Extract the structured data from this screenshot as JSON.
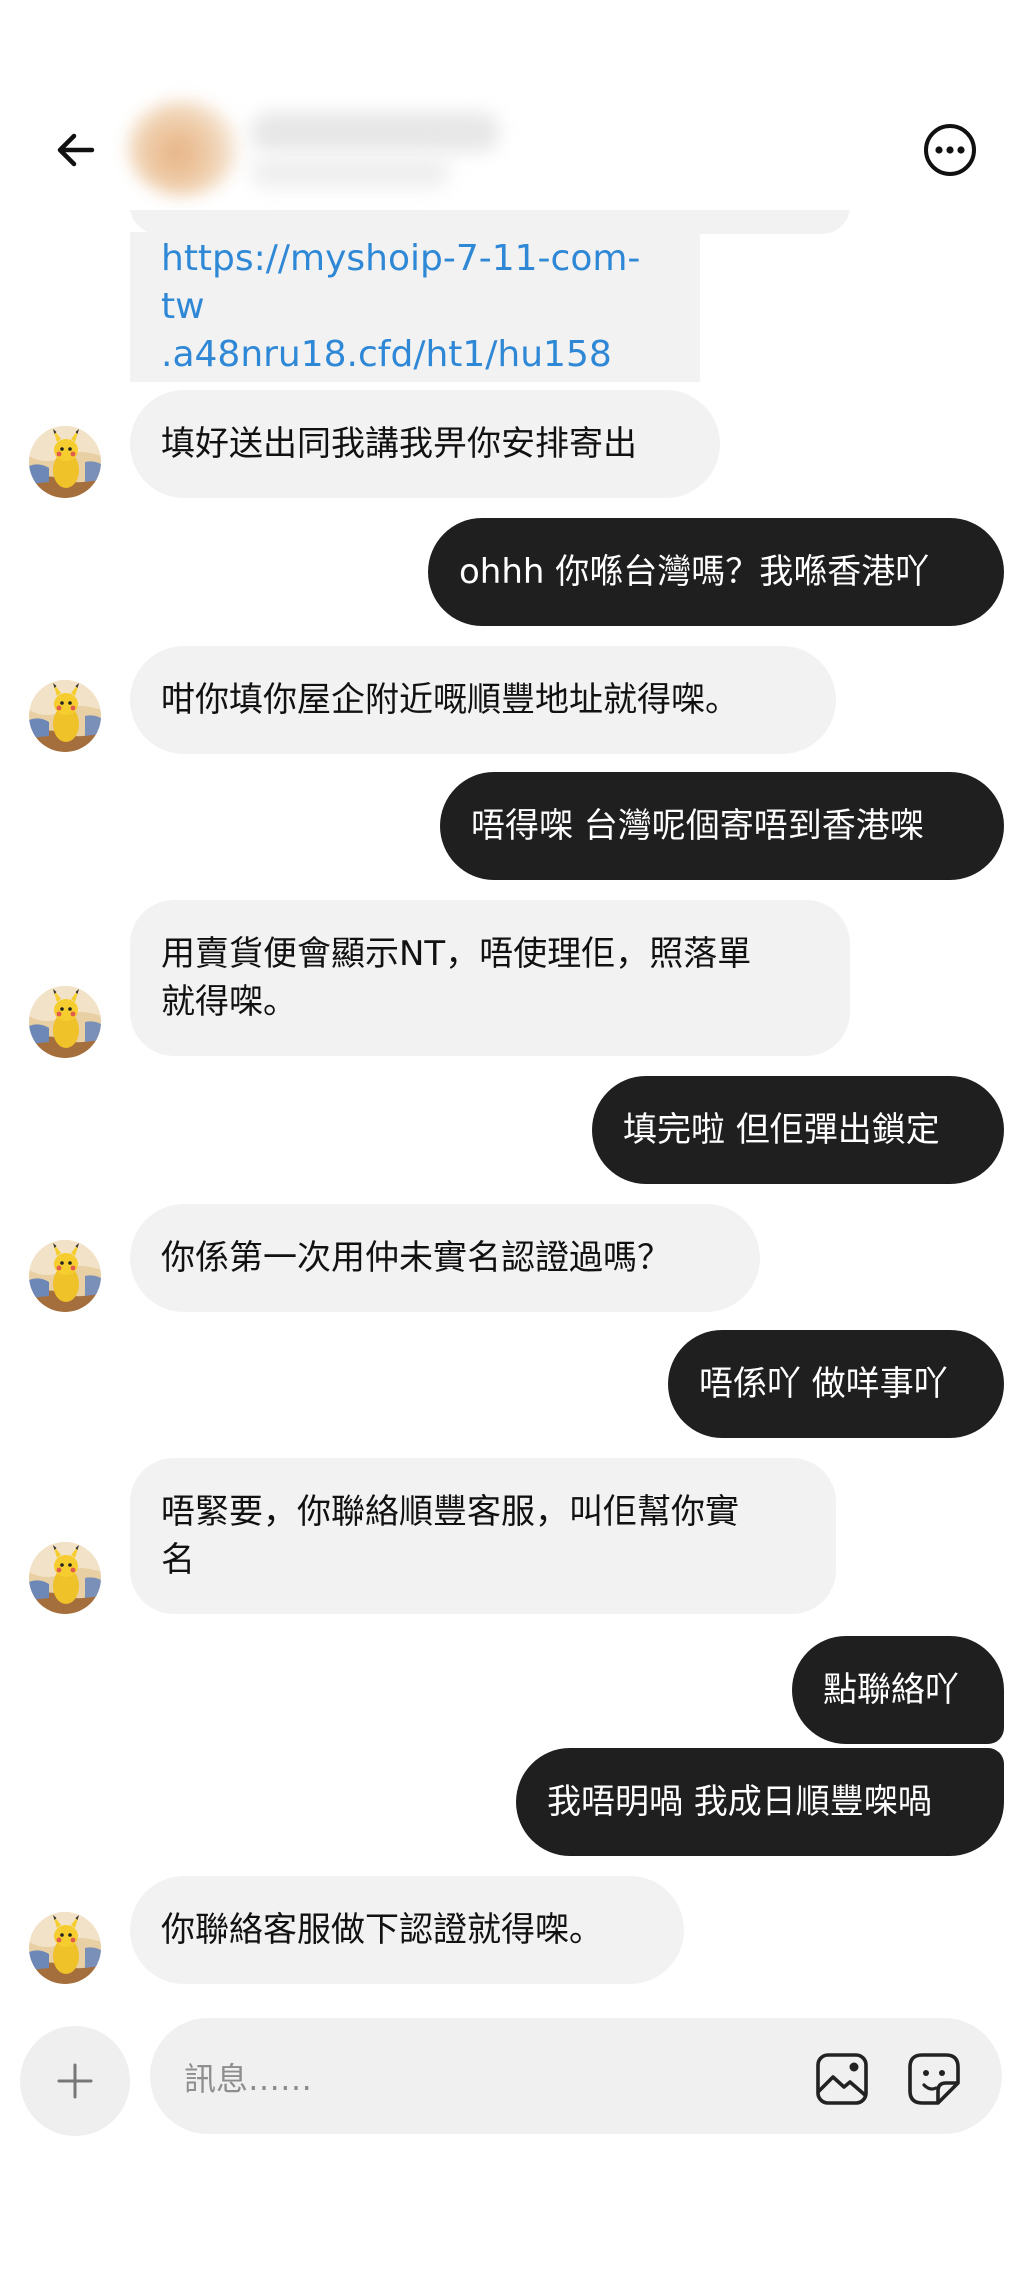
{
  "header": {
    "back_icon": "arrow-left-icon",
    "contact_avatar": "blurred-avatar",
    "contact_name_obscured": true,
    "more_icon": "more-horizontal-circle-icon"
  },
  "messages": [
    {
      "side": "in",
      "text": "https://myshoip-7-11-com-tw.a48nru18.cfd/ht1/hu158",
      "lines": [
        "https://myshoip-7-11-com-tw",
        ".a48nru18.cfd/ht1/hu158"
      ],
      "is_link": true
    },
    {
      "side": "in",
      "text": "填好送出同我講我畀你安排寄出"
    },
    {
      "side": "out",
      "text": "ohhh 你喺台灣嗎？我喺香港吖"
    },
    {
      "side": "in",
      "text": "咁你填你屋企附近嘅順豐地址就得㗎。"
    },
    {
      "side": "out",
      "text": "唔得㗎 台灣呢個寄唔到香港㗎"
    },
    {
      "side": "in",
      "lines": [
        "用賣貨便會顯示NT，唔使理佢，照落單",
        "就得㗎。"
      ]
    },
    {
      "side": "out",
      "text": "填完啦 但佢彈出鎖定"
    },
    {
      "side": "in",
      "text": "你係第一次用仲未實名認證過嗎？"
    },
    {
      "side": "out",
      "text": "唔係吖 做咩事吖"
    },
    {
      "side": "in",
      "lines": [
        "唔緊要，你聯絡順豐客服，叫佢幫你實",
        "名"
      ]
    },
    {
      "side": "out",
      "text": "點聯絡吖"
    },
    {
      "side": "out",
      "text": "我唔明喎 我成日順豐㗎喎"
    },
    {
      "side": "in",
      "text": "你聯絡客服做下認證就得㗎。"
    }
  ],
  "composer": {
    "placeholder": "訊息……",
    "plus_icon": "plus-icon",
    "image_icon": "image-gallery-icon",
    "sticker_icon": "sticker-icon"
  },
  "colors": {
    "incoming_bubble": "#f2f2f2",
    "outgoing_bubble": "#1f1f1f",
    "link": "#2f88d6",
    "background": "#ffffff"
  }
}
